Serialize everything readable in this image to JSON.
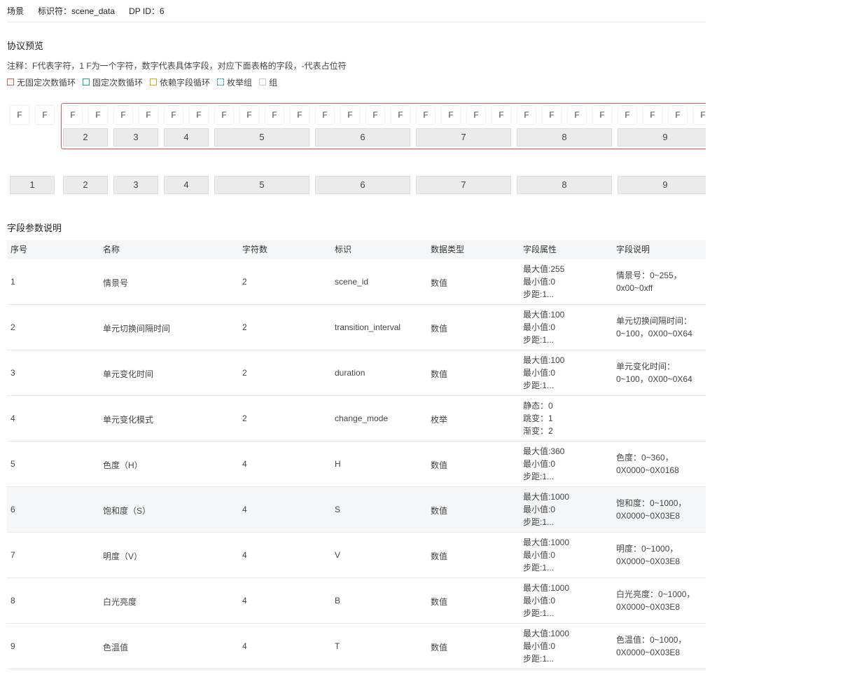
{
  "header": {
    "scene_label": "场景",
    "identifier": "标识符：scene_data",
    "dp_id": "DP ID：6"
  },
  "preview": {
    "title": "协议预览",
    "note": "注释：F代表字符，1 F为一个字符，数字代表具体字段，对应下面表格的字段，-代表占位符",
    "legend": [
      {
        "label": "无固定次数循环",
        "color": "#e05a4e",
        "style": "solid"
      },
      {
        "label": "固定次数循环",
        "color": "#2aa07a",
        "style": "solid"
      },
      {
        "label": "依赖字段循环",
        "color": "#e0a020",
        "style": "solid"
      },
      {
        "label": "枚举组",
        "color": "#3a98d8",
        "style": "dashed"
      },
      {
        "label": "组",
        "color": "#c8c8c8",
        "style": "solid"
      }
    ],
    "f_char": "F",
    "top_fields": [
      "2",
      "3",
      "4",
      "5",
      "6",
      "7",
      "8",
      "9"
    ],
    "bottom_fields": [
      "1",
      "2",
      "3",
      "4",
      "5",
      "6",
      "7",
      "8",
      "9"
    ]
  },
  "fields": {
    "title": "字段参数说明",
    "columns": [
      "序号",
      "名称",
      "字符数",
      "标识",
      "数据类型",
      "字段属性",
      "字段说明"
    ],
    "rows": [
      {
        "no": "1",
        "name": "情景号",
        "chars": "2",
        "id": "scene_id",
        "type": "数值",
        "attrs": [
          "最大值:255",
          "最小值:0",
          "步距:1..."
        ],
        "desc": [
          "情景号：0~255，",
          "0x00~0xff"
        ]
      },
      {
        "no": "2",
        "name": "单元切换间隔时间",
        "chars": "2",
        "id": "transition_interval",
        "type": "数值",
        "attrs": [
          "最大值:100",
          "最小值:0",
          "步距:1..."
        ],
        "desc": [
          "单元切换间隔时间：",
          "0~100，0X00~0X64"
        ]
      },
      {
        "no": "3",
        "name": "单元变化时间",
        "chars": "2",
        "id": "duration",
        "type": "数值",
        "attrs": [
          "最大值:100",
          "最小值:0",
          "步距:1..."
        ],
        "desc": [
          "单元变化时间：",
          "0~100，0X00~0X64"
        ]
      },
      {
        "no": "4",
        "name": "单元变化模式",
        "chars": "2",
        "id": "change_mode",
        "type": "枚举",
        "attrs": [
          "静态：0",
          "跳变：1",
          "渐变：2"
        ],
        "desc": []
      },
      {
        "no": "5",
        "name": "色度（H）",
        "chars": "4",
        "id": "H",
        "type": "数值",
        "attrs": [
          "最大值:360",
          "最小值:0",
          "步距:1..."
        ],
        "desc": [
          "色度：0~360，",
          "0X0000~0X0168"
        ]
      },
      {
        "no": "6",
        "name": "饱和度（S）",
        "chars": "4",
        "id": "S",
        "type": "数值",
        "attrs": [
          "最大值:1000",
          "最小值:0",
          "步距:1..."
        ],
        "desc": [
          "饱和度：0~1000，",
          "0X0000~0X03E8"
        ]
      },
      {
        "no": "7",
        "name": "明度（V）",
        "chars": "4",
        "id": "V",
        "type": "数值",
        "attrs": [
          "最大值:1000",
          "最小值:0",
          "步距:1..."
        ],
        "desc": [
          "明度：0~1000，",
          "0X0000~0X03E8"
        ]
      },
      {
        "no": "8",
        "name": "白光亮度",
        "chars": "4",
        "id": "B",
        "type": "数值",
        "attrs": [
          "最大值:1000",
          "最小值:0",
          "步距:1..."
        ],
        "desc": [
          "白光亮度：0~1000，",
          "0X0000~0X03E8"
        ]
      },
      {
        "no": "9",
        "name": "色温值",
        "chars": "4",
        "id": "T",
        "type": "数值",
        "attrs": [
          "最大值:1000",
          "最小值:0",
          "步距:1..."
        ],
        "desc": [
          "色温值：0~1000，",
          "0X0000~0X03E8"
        ]
      }
    ]
  }
}
